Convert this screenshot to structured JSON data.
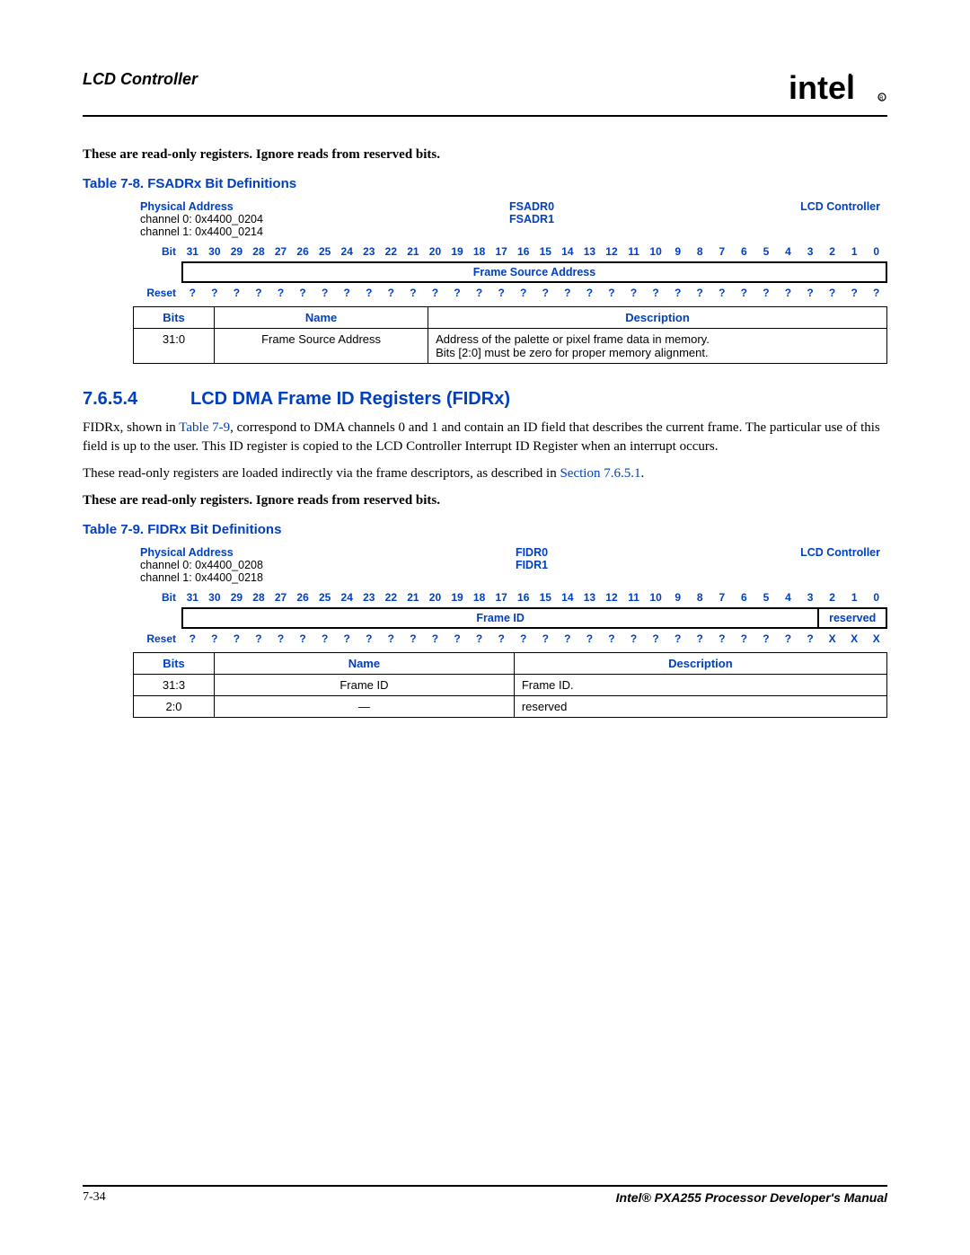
{
  "header": {
    "title": "LCD Controller",
    "logo_alt": "intel"
  },
  "intro_note": "These are read-only registers. Ignore reads from reserved bits.",
  "table8": {
    "caption": "Table 7-8. FSADRx Bit Definitions",
    "phys_label": "Physical Address",
    "phys_lines": [
      "channel 0: 0x4400_0204",
      "channel 1: 0x4400_0214"
    ],
    "reg_names": [
      "FSADR0",
      "FSADR1"
    ],
    "module": "LCD Controller",
    "field_full": "Frame Source Address",
    "reset_all": "?",
    "cols": {
      "bits": "Bits",
      "name": "Name",
      "desc": "Description"
    },
    "rows": [
      {
        "bits": "31:0",
        "name": "Frame Source Address",
        "desc": "Address of the palette or pixel frame data in memory.\nBits [2:0] must be zero for proper memory alignment."
      }
    ]
  },
  "section": {
    "num": "7.6.5.4",
    "title": "LCD DMA Frame ID Registers (FIDRx)",
    "p1a": "FIDRx, shown in ",
    "p1_link": "Table 7-9",
    "p1b": ", correspond to DMA channels 0 and 1 and contain an ID field that describes the current frame. The particular use of this field is up to the user. This ID register is copied to the LCD Controller Interrupt ID Register when an interrupt occurs.",
    "p2a": "These read-only registers are loaded indirectly via the frame descriptors, as described in ",
    "p2_link": "Section 7.6.5.1",
    "p2b": ".",
    "note": "These are read-only registers. Ignore reads from reserved bits."
  },
  "table9": {
    "caption": "Table 7-9. FIDRx Bit Definitions",
    "phys_label": "Physical Address",
    "phys_lines": [
      "channel 0: 0x4400_0208",
      "channel 1: 0x4400_0218"
    ],
    "reg_names": [
      "FIDR0",
      "FIDR1"
    ],
    "module": "LCD Controller",
    "field_main": "Frame ID",
    "field_res": "reserved",
    "reset_q": "?",
    "reset_x": "X",
    "cols": {
      "bits": "Bits",
      "name": "Name",
      "desc": "Description"
    },
    "rows": [
      {
        "bits": "31:3",
        "name": "Frame ID",
        "desc": "Frame ID."
      },
      {
        "bits": "2:0",
        "name": "—",
        "desc": "reserved"
      }
    ]
  },
  "labels": {
    "bit": "Bit",
    "reset": "Reset"
  },
  "footer": {
    "page": "7-34",
    "doc": "Intel® PXA255 Processor Developer's Manual"
  }
}
